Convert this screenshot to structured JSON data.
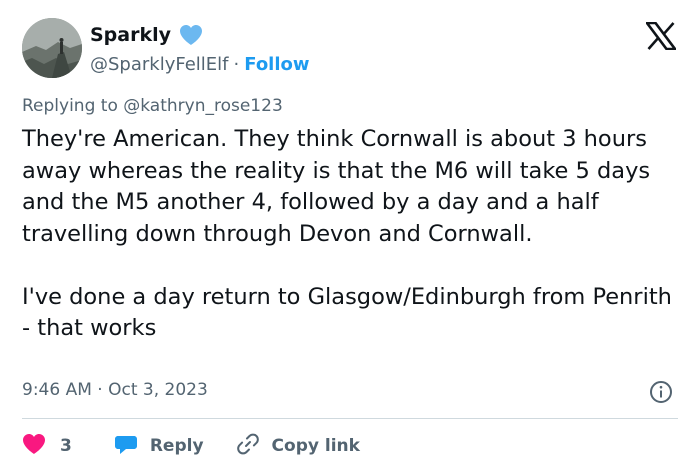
{
  "author": {
    "display_name": "Sparkly",
    "handle": "@SparklyFellElf",
    "separator": "·",
    "follow_label": "Follow"
  },
  "tweet": {
    "replying_prefix": "Replying to",
    "replying_to": "@kathryn_rose123",
    "paragraphs": [
      "They're American. They think Cornwall is about 3 hours away whereas the reality is that the M6 will take 5 days and the M5 another 4, followed by a day and a half travelling down through Devon and Cornwall.",
      "I've done a day return to Glasgow/Edinburgh from Penrith - that works"
    ],
    "timestamp": "9:46 AM · Oct 3, 2023"
  },
  "actions": {
    "like_count": "3",
    "reply_label": "Reply",
    "copy_link_label": "Copy link"
  },
  "icons": {
    "verified": "verified-heart-icon",
    "brand": "x-logo-icon",
    "info": "info-icon",
    "like": "heart-icon",
    "reply": "reply-bubble-icon",
    "copy": "link-icon"
  },
  "colors": {
    "accent": "#1d9bf0",
    "like": "#f91880",
    "text": "#0f1419",
    "muted": "#536471",
    "divider": "#cfd9de"
  }
}
